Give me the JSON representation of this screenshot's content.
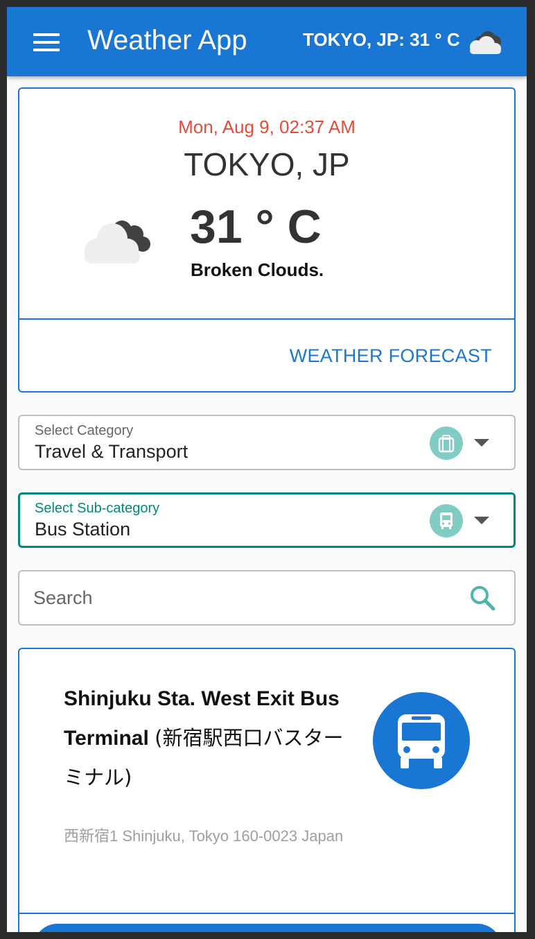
{
  "app_bar": {
    "title": "Weather App",
    "weather_summary": "TOKYO, JP: 31 ° C",
    "menu_icon": "hamburger-menu-icon",
    "weather_icon": "broken-clouds-icon",
    "background_color": "#1976d2"
  },
  "weather_card": {
    "datetime": "Mon, Aug 9, 02:37 AM",
    "city": "TOKYO, JP",
    "temperature": "31 ° C",
    "description": "Broken Clouds.",
    "weather_icon": "broken-clouds-icon",
    "forecast_button": "WEATHER FORECAST",
    "datetime_color": "#e84a3a"
  },
  "category_select": {
    "label": "Select Category",
    "value": "Travel & Transport",
    "icon": "luggage-icon"
  },
  "subcategory_select": {
    "label": "Select Sub-category",
    "value": "Bus Station",
    "icon": "bus-icon",
    "accent_color": "#00897b"
  },
  "search": {
    "placeholder": "Search",
    "value": "",
    "icon": "search-icon"
  },
  "results": [
    {
      "title_en": "Shinjuku Sta. West Exit Bus Terminal",
      "title_jp": "(新宿駅西口バスターミナル)",
      "address": "西新宿1 Shinjuku, Tokyo 160-0023 Japan",
      "icon": "bus-icon"
    }
  ]
}
